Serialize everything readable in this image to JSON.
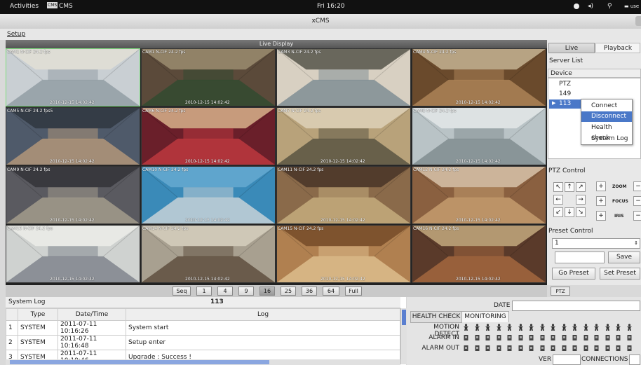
{
  "topbar": {
    "activities": "Activities",
    "app_badge": "CMS",
    "app_name": "CMS",
    "clock": "Fri 16:20",
    "user": "use"
  },
  "window": {
    "title": "xCMS"
  },
  "menu": {
    "setup": "Setup"
  },
  "live": {
    "title": "Live Display",
    "cameras": [
      {
        "label": "CAM1 N-CIF 24.2 fps",
        "time": "2010-12-15 14:02:42"
      },
      {
        "label": "CAM1 N-CIF 24.2 fps",
        "time": "2010-12-15 14:02:42"
      },
      {
        "label": "CAM3 N-CIF 24.2 fps",
        "time": ""
      },
      {
        "label": "CAM4 N-CIF 24.2 fps",
        "time": "2010-12-15 14:02:42"
      },
      {
        "label": "CAM5 N-CIF 24.2 fps5",
        "time": "2010-12-15 14:02:42"
      },
      {
        "label": "CAM6 N-CIF 24.2 fps",
        "time": "2010-12-15 14:02:42"
      },
      {
        "label": "CAM7 N-CIF 24.2 fps",
        "time": "2010-12-15 14:02:42"
      },
      {
        "label": "CAM8 N-CIF 24.2 fps",
        "time": "2010-12-15 14:02:42"
      },
      {
        "label": "CAM9 N-CIF 24.2 fps",
        "time": "2010-12-15 14:02:42"
      },
      {
        "label": "CAM10 N-CIF 24.2 fps",
        "time": "2010-12-15 14:02:42"
      },
      {
        "label": "CAM11 N-CIF 24.2 fps",
        "time": "2010-12-15 14:02:42"
      },
      {
        "label": "CAM12 N-CIF 24.2 fps",
        "time": "2010-12-15 14:02:42"
      },
      {
        "label": "CAM13 N-CIF 24.2 fps",
        "time": "2010-12-15 14:02:42"
      },
      {
        "label": "CAM14 N-CIF 24.2 fps",
        "time": "2010-12-15 14:02:42"
      },
      {
        "label": "CAM15 N-CIF 24.2 fps",
        "time": "2010-12-15 14:02:42"
      },
      {
        "label": "CAM16 N-CIF 24.2 fps",
        "time": "2010-12-15 14:02:42"
      }
    ]
  },
  "layout": {
    "buttons": [
      "Seq",
      "1",
      "4",
      "9",
      "16",
      "25",
      "36",
      "64",
      "Full"
    ],
    "active": "16",
    "ptz": "PTZ"
  },
  "right": {
    "tabs": [
      "Live",
      "Playback"
    ],
    "server_list": "Server List",
    "device_header": "Device",
    "devices": [
      "PTZ",
      "149",
      "113"
    ],
    "context_menu": [
      "Connect",
      "Disconnect",
      "Health check",
      "System Log"
    ],
    "context_highlight": "Disconnect",
    "ptz_control": "PTZ Control",
    "arrows": [
      "↖",
      "↑",
      "↗",
      "←",
      "",
      "→",
      "↙",
      "↓",
      "↘"
    ],
    "zoom": "ZOOM",
    "focus": "FOCUS",
    "iris": "IRIS",
    "preset_control": "Preset Control",
    "preset_value": "1",
    "save": "Save",
    "go_preset": "Go Preset",
    "set_preset": "Set Preset"
  },
  "log": {
    "title": "System Log",
    "device": "113",
    "columns": [
      "",
      "Type",
      "Date/Time",
      "Log"
    ],
    "rows": [
      [
        "1",
        "SYSTEM",
        "2011-07-11 10:16:26",
        "System start"
      ],
      [
        "2",
        "SYSTEM",
        "2011-07-11 10:16:48",
        "Setup enter"
      ],
      [
        "3",
        "SYSTEM",
        "2011-07-11 10:19:46",
        "Upgrade : Success !"
      ]
    ]
  },
  "monitor": {
    "date_label": "DATE",
    "tabs": [
      "HEALTH CHECK",
      "MONITORING"
    ],
    "rows": [
      "MOTION DETECT",
      "ALARM IN",
      "ALARM OUT"
    ],
    "ver_label": "VER",
    "connections_label": "CONNECTIONS"
  },
  "colors": {
    "accent": "#4a78c8",
    "selected_cam": "#7ee07e"
  }
}
